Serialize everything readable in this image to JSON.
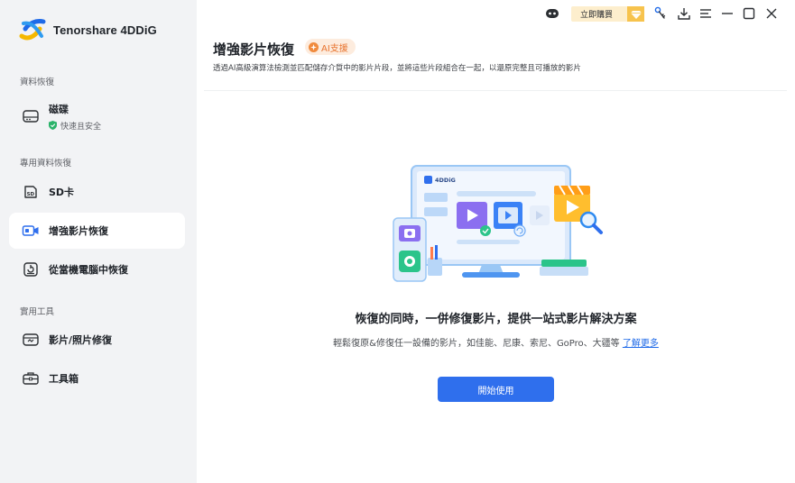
{
  "app": {
    "name": "Tenorshare 4DDiG"
  },
  "titlebar": {
    "buy_label": "立即購買",
    "icons": [
      "assistant-robot-icon",
      "diamond-icon",
      "key-icon",
      "download-icon",
      "menu-icon",
      "minimize-icon",
      "maximize-icon",
      "close-icon"
    ]
  },
  "sidebar": {
    "sections": [
      {
        "label": "資料恢復"
      },
      {
        "label": "專用資料恢復"
      },
      {
        "label": "實用工具"
      }
    ],
    "items": [
      {
        "label": "磁碟",
        "sub": "快速且安全",
        "icon": "disk-icon"
      },
      {
        "label": "SD卡",
        "icon": "sd-card-icon"
      },
      {
        "label": "增強影片恢復",
        "icon": "video-camera-icon",
        "active": true
      },
      {
        "label": "從當機電腦中恢復",
        "icon": "crashed-computer-icon"
      },
      {
        "label": "影片/照片修復",
        "icon": "photo-repair-icon"
      },
      {
        "label": "工具箱",
        "icon": "toolbox-icon"
      }
    ]
  },
  "header": {
    "title": "增強影片恢復",
    "ai_badge": "AI支援",
    "description": "透過AI高級演算法檢測並匹配儲存介質中的影片片段，並將這些片段組合在一起，以還原完整且可播放的影片"
  },
  "illustration": {
    "screen_brand": "4DDiG"
  },
  "main": {
    "headline": "恢復的同時，一併修復影片，提供一站式影片解決方案",
    "subline": "輕鬆復原&修復任一設備的影片，如佳能、尼康、索尼、GoPro、大疆等",
    "learn_more": "了解更多",
    "start_button": "開始使用"
  },
  "colors": {
    "accent": "#2f6fed",
    "sidebar_bg": "#f2f3f5",
    "ai_badge": "#e8742f",
    "buy_bg": "#fdeecd"
  }
}
